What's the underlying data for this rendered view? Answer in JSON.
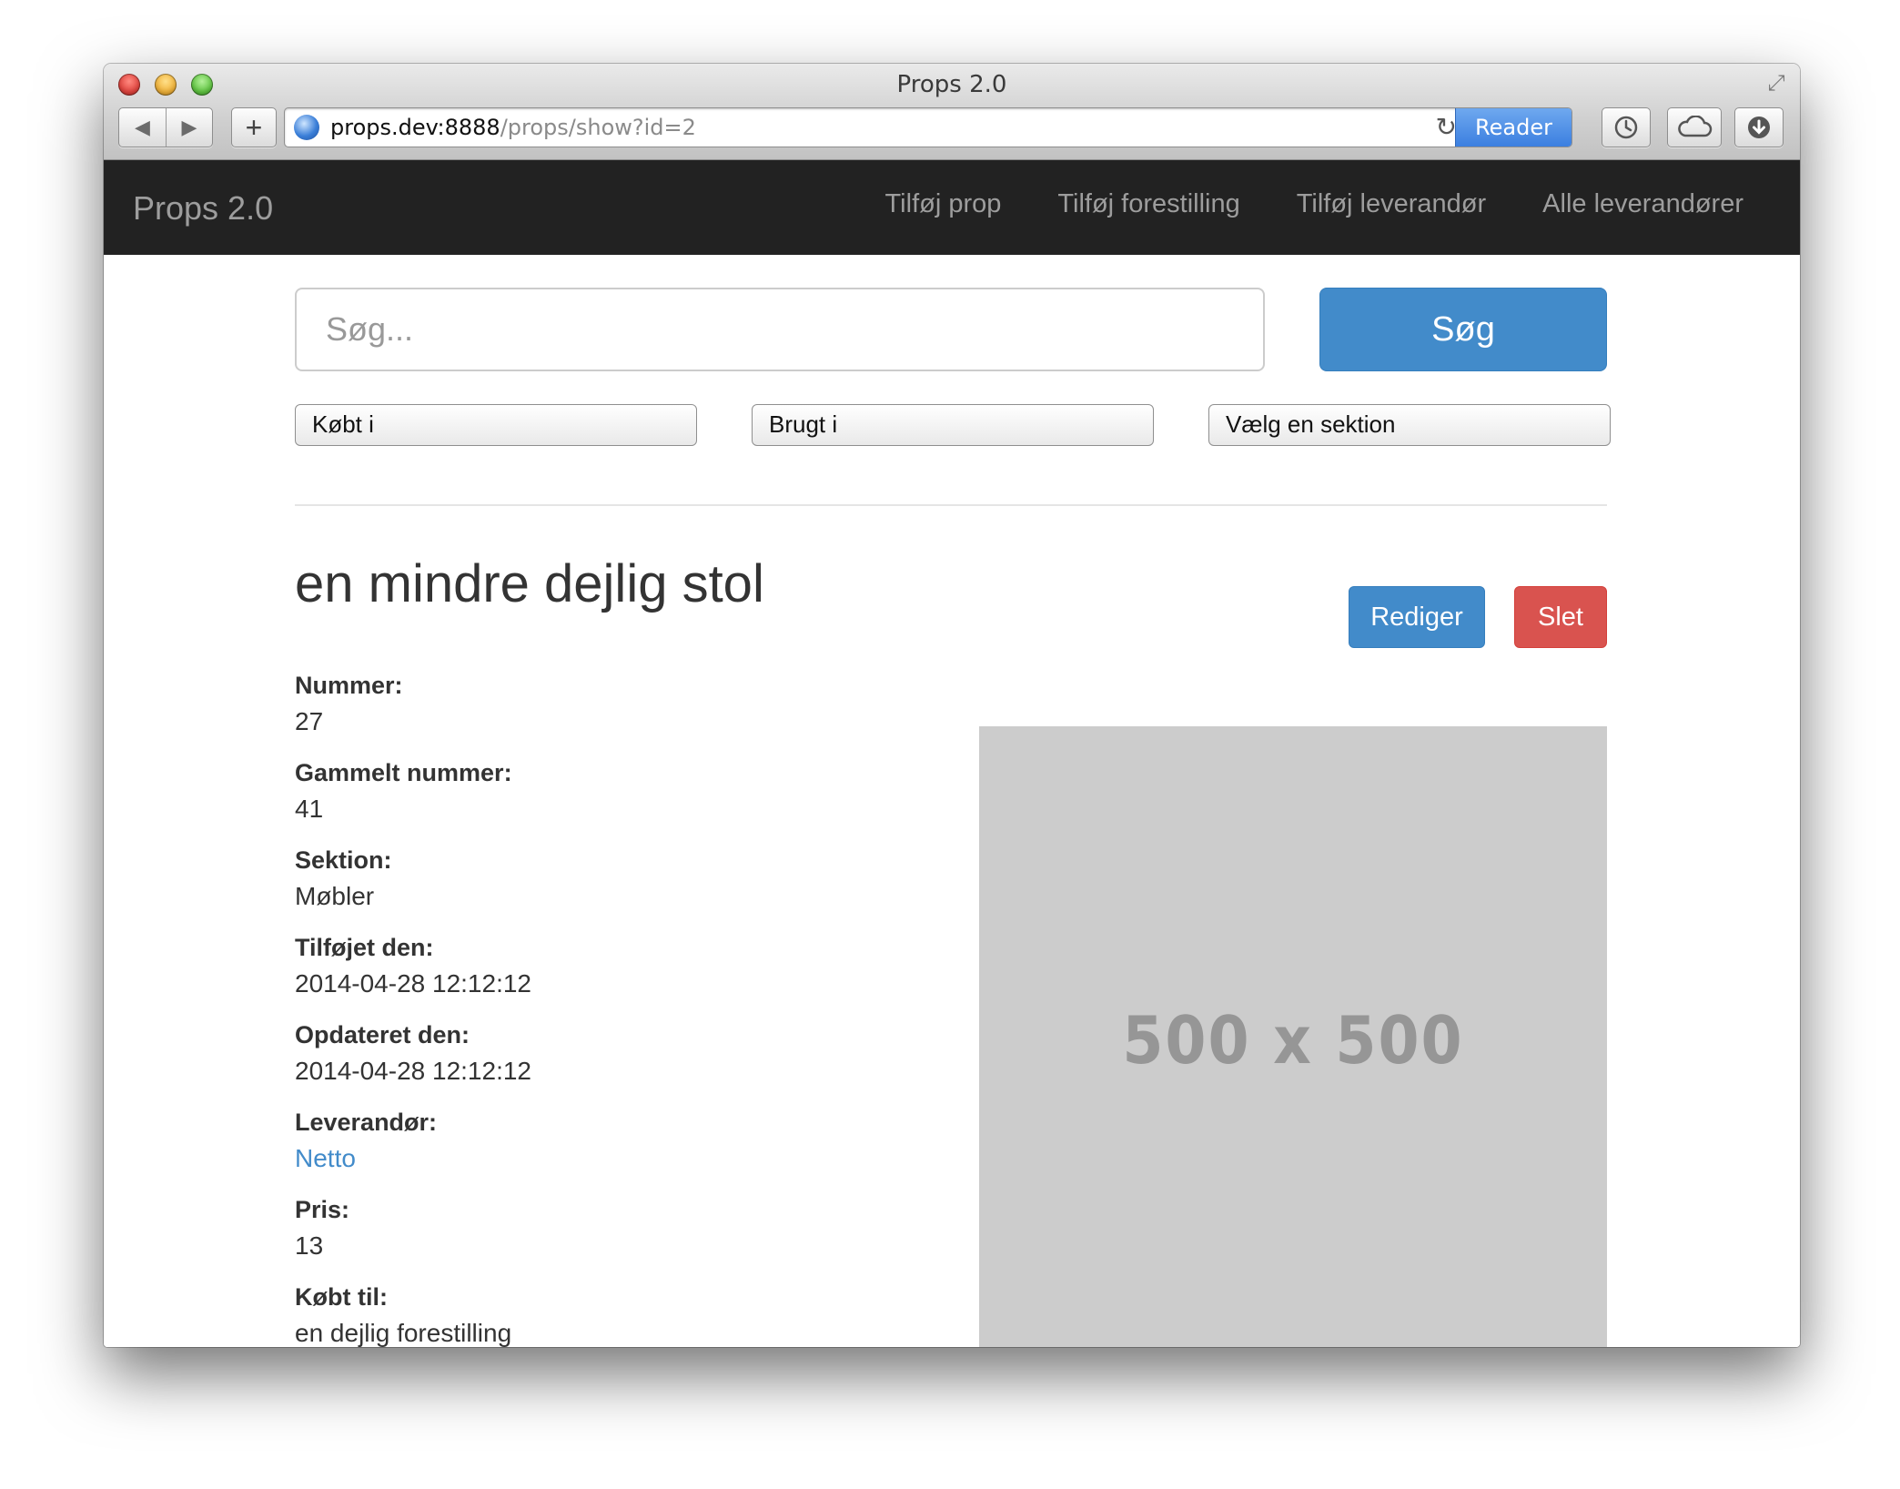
{
  "browser": {
    "title": "Props 2.0",
    "url_host": "props.dev:8888",
    "url_path": "/props/show?id=2",
    "reader_label": "Reader",
    "back_glyph": "◀",
    "forward_glyph": "▶",
    "add_tab_glyph": "+",
    "reload_glyph": "↻"
  },
  "navbar": {
    "brand": "Props 2.0",
    "links": [
      "Tilføj prop",
      "Tilføj forestilling",
      "Tilføj leverandør",
      "Alle leverandører"
    ]
  },
  "search": {
    "placeholder": "Søg...",
    "button_label": "Søg",
    "filters": [
      "Købt i",
      "Brugt i",
      "Vælg en sektion"
    ]
  },
  "prop": {
    "title": "en mindre dejlig stol",
    "edit_label": "Rediger",
    "delete_label": "Slet",
    "fields": [
      {
        "label": "Nummer:",
        "value": "27"
      },
      {
        "label": "Gammelt nummer:",
        "value": "41"
      },
      {
        "label": "Sektion:",
        "value": "Møbler"
      },
      {
        "label": "Tilføjet den:",
        "value": "2014-04-28 12:12:12"
      },
      {
        "label": "Opdateret den:",
        "value": "2014-04-28 12:12:12"
      },
      {
        "label": "Leverandør:",
        "value": "Netto"
      },
      {
        "label": "Pris:",
        "value": "13"
      },
      {
        "label": "Købt til:",
        "value": "en dejlig forestilling"
      }
    ],
    "image_placeholder": "500 x 500"
  },
  "colors": {
    "navbar_bg": "#222222",
    "primary": "#428bca",
    "danger": "#d9534f",
    "link": "#428bca",
    "placeholder_bg": "#cccccc"
  }
}
